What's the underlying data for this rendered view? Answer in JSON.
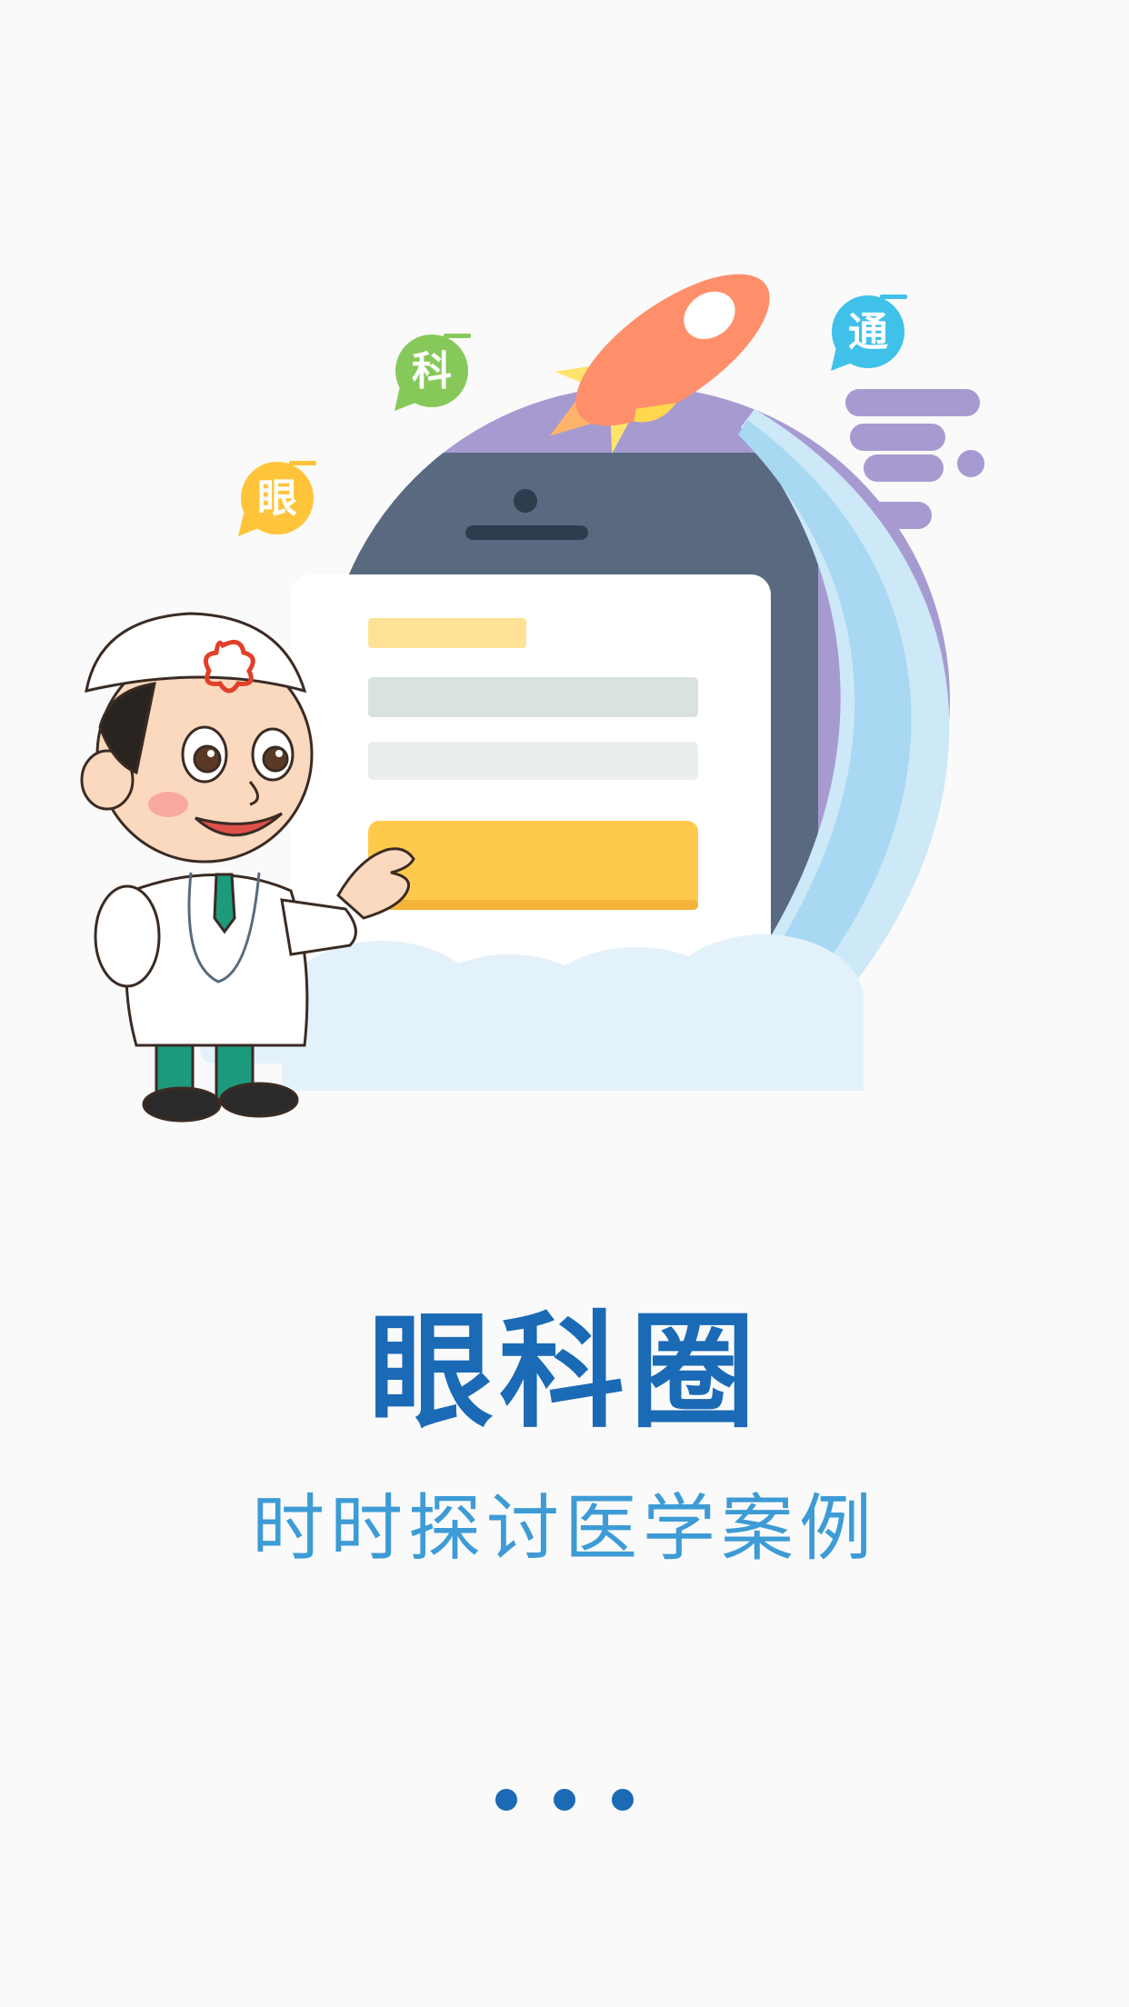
{
  "title": "眼科圈",
  "subtitle": "时时探讨医学案例",
  "bubbles": {
    "eye": "眼",
    "department": "科",
    "connect": "通"
  },
  "pager": {
    "count": 3
  },
  "colors": {
    "background": "#fafafa",
    "title": "#1a6ab6",
    "subtitle": "#3d9bd6",
    "dot": "#1a6ab6",
    "bubble_eye": "#ffc43a",
    "bubble_department": "#86c95a",
    "bubble_connect": "#3fc1ea",
    "circle_purple": "#a79ad1",
    "phone_body": "#596a80",
    "rocket": "#ff8f6b",
    "panel_button": "#ffc94c"
  }
}
